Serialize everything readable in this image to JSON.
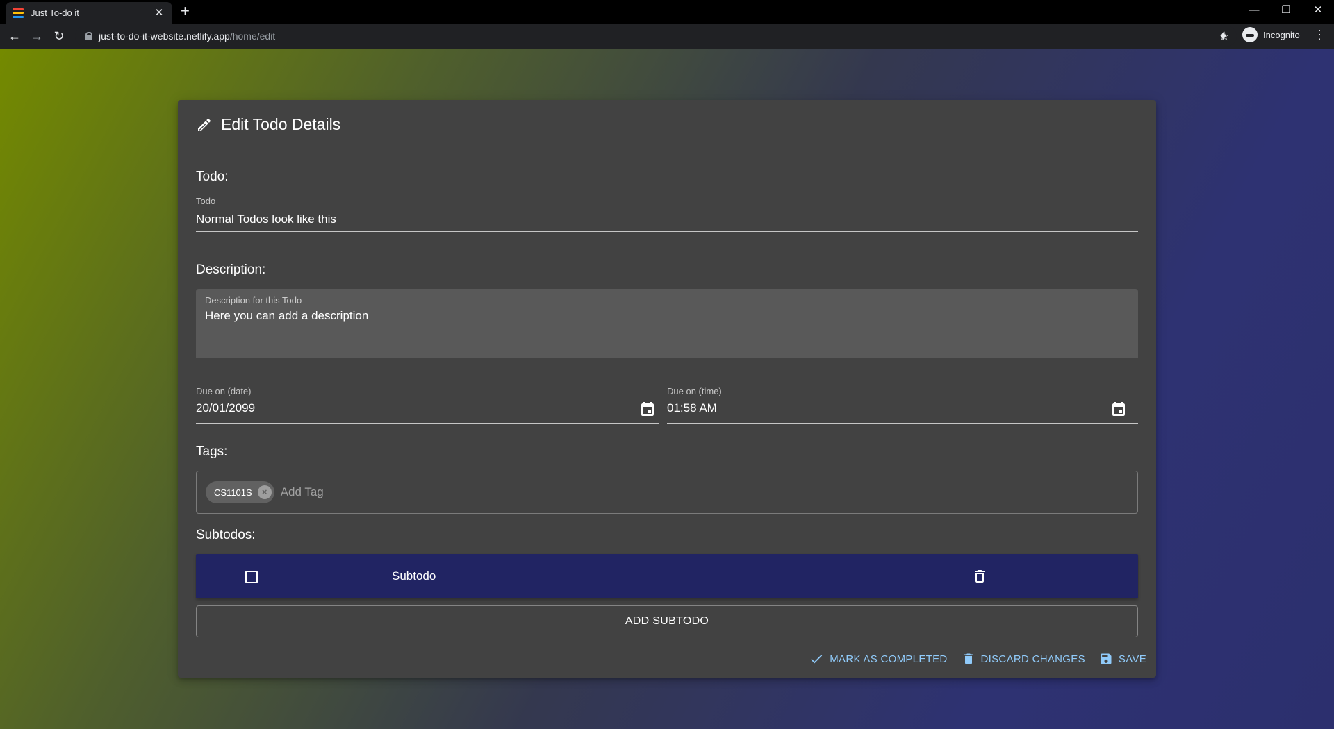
{
  "browser": {
    "tab_title": "Just To-do it",
    "url_host": "just-to-do-it-website.netlify.app",
    "url_path": "/home/edit",
    "profile_label": "Incognito"
  },
  "card": {
    "title": "Edit Todo Details"
  },
  "todo": {
    "section_label": "Todo:",
    "field_label": "Todo",
    "value": "Normal Todos look like this"
  },
  "description": {
    "section_label": "Description:",
    "field_label": "Description for this Todo",
    "value": "Here you can add a description"
  },
  "due": {
    "date_label": "Due on (date)",
    "date_value": "20/01/2099",
    "time_label": "Due on (time)",
    "time_value": "01:58 AM"
  },
  "tags": {
    "section_label": "Tags:",
    "items": [
      "CS1101S"
    ],
    "placeholder": "Add Tag"
  },
  "subtodos": {
    "section_label": "Subtodos:",
    "items": [
      {
        "text": "Subtodo",
        "checked": false
      }
    ],
    "add_button": "ADD SUBTODO"
  },
  "actions": {
    "mark_completed": "MARK AS COMPLETED",
    "discard": "DISCARD CHANGES",
    "save": "SAVE"
  },
  "colors": {
    "card_bg": "#424242",
    "subtodo_bg": "#212463",
    "action_text": "#90caf9"
  }
}
